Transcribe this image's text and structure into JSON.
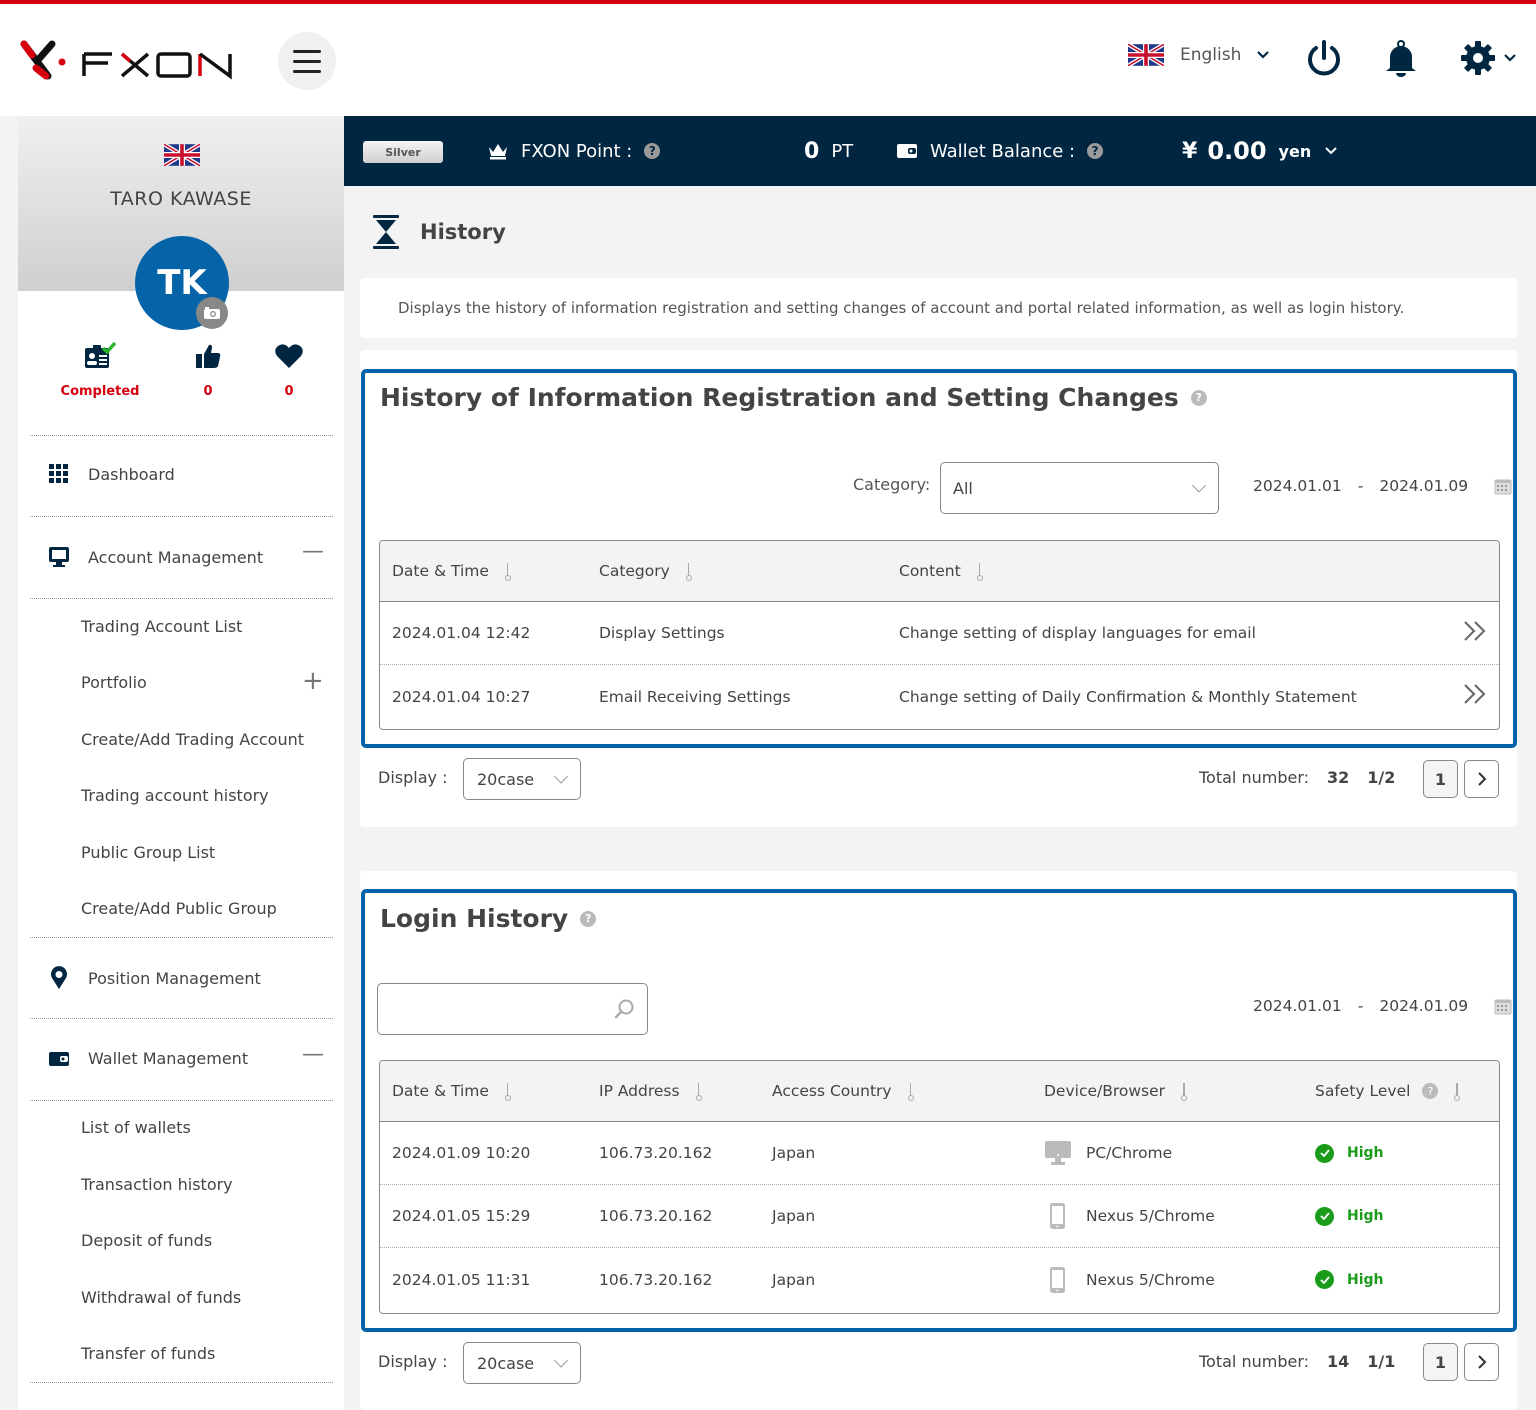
{
  "header": {
    "brand": "FXON",
    "language": "English",
    "icons": [
      "menu-icon",
      "uk-flag-icon",
      "power-icon",
      "bell-icon",
      "gear-icon"
    ]
  },
  "statusbar": {
    "rank": "Silver",
    "point_label": "FXON Point :",
    "point_value": "0",
    "point_unit": "PT",
    "wallet_label": "Wallet Balance :",
    "wallet_currency_symbol": "¥",
    "wallet_value": "0.00",
    "wallet_unit": "yen"
  },
  "profile": {
    "name": "TARO KAWASE",
    "initials": "TK",
    "stats": [
      {
        "icon": "id-card-check-icon",
        "label": "Completed"
      },
      {
        "icon": "thumbs-up-icon",
        "label": "0"
      },
      {
        "icon": "heart-icon",
        "label": "0"
      }
    ]
  },
  "sidebar": {
    "dashboard": "Dashboard",
    "account_management": "Account Management",
    "account_items": [
      "Trading Account List",
      "Portfolio",
      "Create/Add Trading Account",
      "Trading account history",
      "Public Group List",
      "Create/Add Public Group"
    ],
    "position_management": "Position Management",
    "wallet_management": "Wallet Management",
    "wallet_items": [
      "List of wallets",
      "Transaction history",
      "Deposit of funds",
      "Withdrawal of funds",
      "Transfer of funds"
    ]
  },
  "page": {
    "title": "History",
    "description": "Displays the history of information registration and setting changes of account and portal related information, as well as login history."
  },
  "settings_history": {
    "title": "History of Information Registration and Setting Changes",
    "category_label": "Category:",
    "category_value": "All",
    "date_from": "2024.01.01",
    "date_sep": "-",
    "date_to": "2024.01.09",
    "columns": [
      "Date & Time",
      "Category",
      "Content"
    ],
    "rows": [
      {
        "datetime": "2024.01.04 12:42",
        "category": "Display Settings",
        "content": "Change setting of display languages for email"
      },
      {
        "datetime": "2024.01.04 10:27",
        "category": "Email Receiving Settings",
        "content": "Change setting of Daily Confirmation & Monthly Statement"
      }
    ],
    "display_label": "Display :",
    "display_value": "20case",
    "total_label": "Total number:",
    "total_value": "32",
    "page_info": "1/2",
    "current_page": "1"
  },
  "login_history": {
    "title": "Login History",
    "search_value": "",
    "date_from": "2024.01.01",
    "date_sep": "-",
    "date_to": "2024.01.09",
    "columns": [
      "Date & Time",
      "IP Address",
      "Access Country",
      "Device/Browser",
      "Safety Level"
    ],
    "rows": [
      {
        "datetime": "2024.01.09 10:20",
        "ip": "106.73.20.162",
        "country": "Japan",
        "device_icon": "desktop-icon",
        "device": "PC/Chrome",
        "safety": "High"
      },
      {
        "datetime": "2024.01.05 15:29",
        "ip": "106.73.20.162",
        "country": "Japan",
        "device_icon": "mobile-icon",
        "device": "Nexus 5/Chrome",
        "safety": "High"
      },
      {
        "datetime": "2024.01.05 11:31",
        "ip": "106.73.20.162",
        "country": "Japan",
        "device_icon": "mobile-icon",
        "device": "Nexus 5/Chrome",
        "safety": "High"
      }
    ],
    "display_label": "Display :",
    "display_value": "20case",
    "total_label": "Total number:",
    "total_value": "14",
    "page_info": "1/1",
    "current_page": "1"
  },
  "colors": {
    "brand_red": "#d7000f",
    "navy": "#002641",
    "accent_blue": "#0563a8",
    "success_green": "#1a9c1a"
  }
}
